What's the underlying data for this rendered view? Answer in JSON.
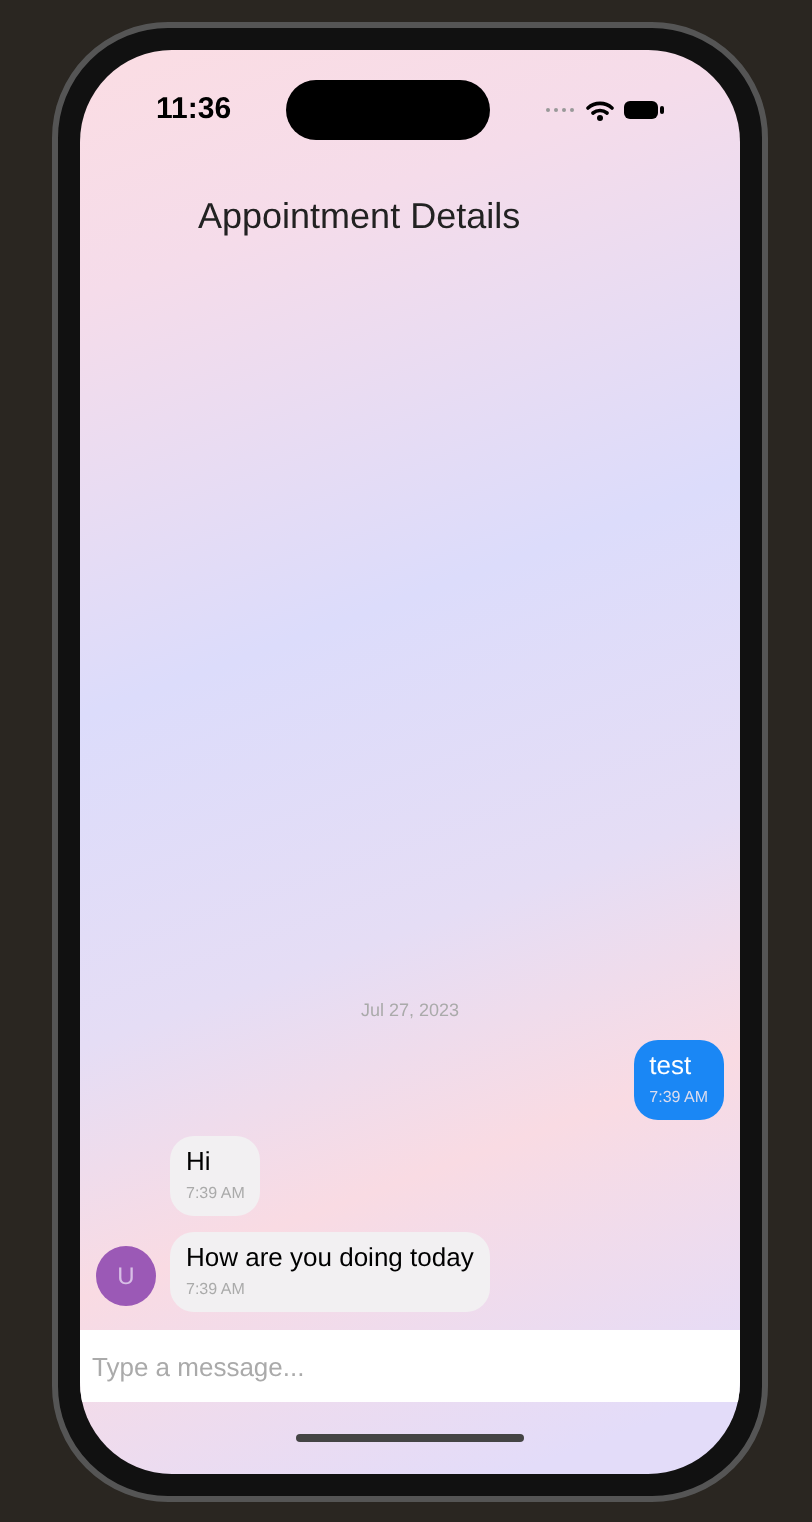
{
  "status_bar": {
    "time": "11:36"
  },
  "header": {
    "title": "Appointment Details"
  },
  "date_separator": "Jul 27, 2023",
  "messages": [
    {
      "kind": "outgoing",
      "text": "test",
      "time": "7:39 AM"
    },
    {
      "kind": "incoming",
      "text": "Hi",
      "time": "7:39 AM"
    },
    {
      "kind": "incoming",
      "text": "How are you doing today",
      "time": "7:39 AM",
      "avatar": "U"
    }
  ],
  "composer": {
    "placeholder": "Type a message..."
  }
}
